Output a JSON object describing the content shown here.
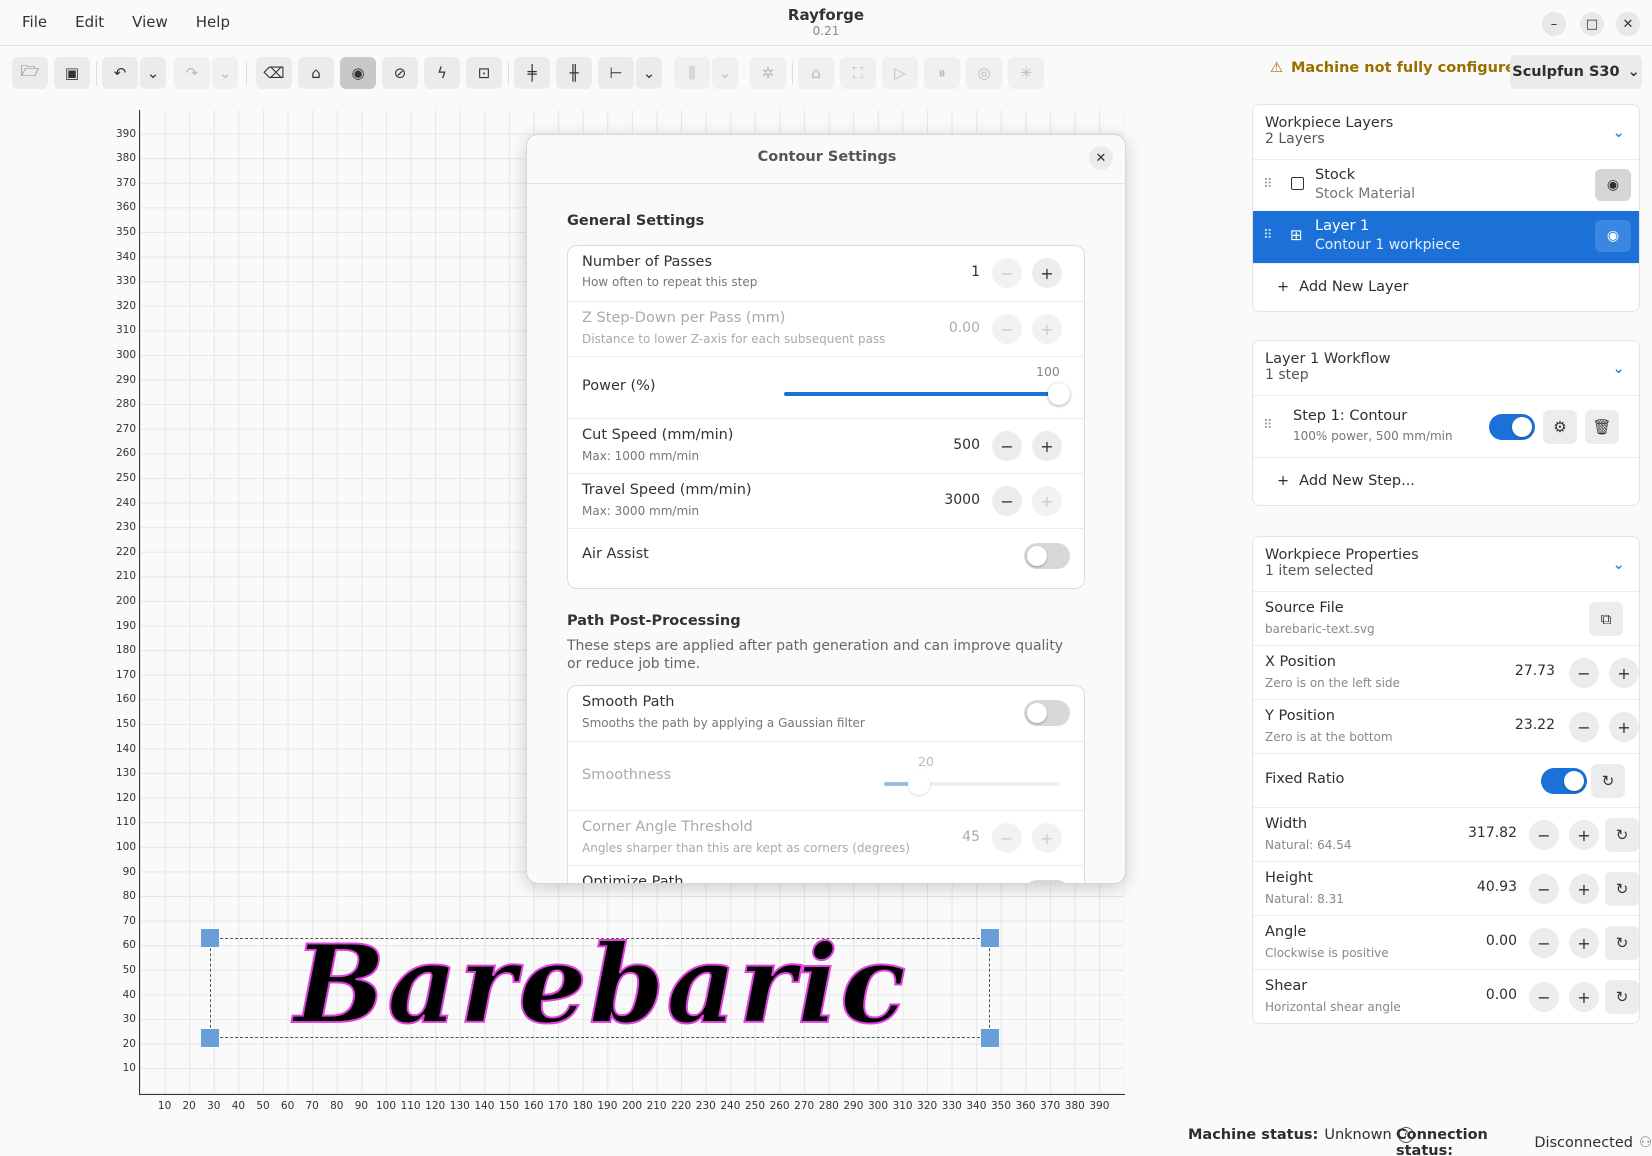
{
  "menu": [
    "File",
    "Edit",
    "View",
    "Help"
  ],
  "app": {
    "title": "Rayforge",
    "version": "0.21"
  },
  "window_controls": {
    "minimize": "–",
    "maximize": "□",
    "close": "✕"
  },
  "toolbar": {
    "warning": "Machine not fully configured",
    "machine": "Sculpfun S30"
  },
  "canvas": {
    "y_ticks": [
      "390",
      "380",
      "370",
      "360",
      "350",
      "340",
      "330",
      "320",
      "310",
      "300",
      "290",
      "280",
      "270",
      "260",
      "250",
      "240",
      "230",
      "220",
      "210",
      "200",
      "190",
      "180",
      "170",
      "160",
      "150",
      "140",
      "130",
      "120",
      "110",
      "100",
      "90",
      "80",
      "70",
      "60",
      "50",
      "40",
      "30",
      "20",
      "10"
    ],
    "x_ticks": [
      "10",
      "20",
      "30",
      "40",
      "50",
      "60",
      "70",
      "80",
      "90",
      "100",
      "110",
      "120",
      "130",
      "140",
      "150",
      "160",
      "170",
      "180",
      "190",
      "200",
      "210",
      "220",
      "230",
      "240",
      "250",
      "260",
      "270",
      "280",
      "290",
      "300",
      "310",
      "320",
      "330",
      "340",
      "350",
      "360",
      "370",
      "380",
      "390"
    ],
    "workpiece_text": "Barebaric"
  },
  "dialog": {
    "title": "Contour Settings",
    "general_title": "General Settings",
    "passes": {
      "label": "Number of Passes",
      "hint": "How often to repeat this step",
      "value": "1"
    },
    "zstep": {
      "label": "Z Step-Down per Pass (mm)",
      "hint": "Distance to lower Z-axis for each subsequent pass",
      "value": "0.00"
    },
    "power": {
      "label": "Power (%)",
      "value": "100"
    },
    "cut_speed": {
      "label": "Cut Speed (mm/min)",
      "hint": "Max: 1000 mm/min",
      "value": "500"
    },
    "travel_speed": {
      "label": "Travel Speed (mm/min)",
      "hint": "Max: 3000 mm/min",
      "value": "3000"
    },
    "air_assist": {
      "label": "Air Assist",
      "on": false
    },
    "post_title": "Path Post-Processing",
    "post_desc": "These steps are applied after path generation and can improve quality or reduce job time.",
    "smooth": {
      "label": "Smooth Path",
      "hint": "Smooths the path by applying a Gaussian filter",
      "on": false
    },
    "smoothness": {
      "label": "Smoothness",
      "value": "20"
    },
    "corner": {
      "label": "Corner Angle Threshold",
      "hint": "Angles sharper than this are kept as corners (degrees)",
      "value": "45"
    },
    "optimize": {
      "label": "Optimize Path"
    }
  },
  "layers_panel": {
    "title": "Workpiece Layers",
    "subtitle": "2 Layers",
    "layers": [
      {
        "name": "Stock",
        "desc": "Stock Material",
        "selected": false
      },
      {
        "name": "Layer 1",
        "desc": "Contour 1 workpiece",
        "selected": true
      }
    ],
    "add_label": "Add New Layer"
  },
  "workflow_panel": {
    "title": "Layer 1 Workflow",
    "subtitle": "1 step",
    "step_name": "Step 1: Contour",
    "step_desc": "100% power, 500 mm/min",
    "step_enabled": true,
    "add_label": "Add New Step..."
  },
  "props_panel": {
    "title": "Workpiece Properties",
    "subtitle": "1 item selected",
    "source_file": {
      "label": "Source File",
      "value": "barebaric-text.svg"
    },
    "x_pos": {
      "label": "X Position",
      "hint": "Zero is on the left side",
      "value": "27.73"
    },
    "y_pos": {
      "label": "Y Position",
      "hint": "Zero is at the bottom",
      "value": "23.22"
    },
    "fixed_ratio": {
      "label": "Fixed Ratio",
      "on": true
    },
    "width": {
      "label": "Width",
      "hint": "Natural: 64.54",
      "value": "317.82"
    },
    "height": {
      "label": "Height",
      "hint": "Natural: 8.31",
      "value": "40.93"
    },
    "angle": {
      "label": "Angle",
      "hint": "Clockwise is positive",
      "value": "0.00"
    },
    "shear": {
      "label": "Shear",
      "hint": "Horizontal shear angle",
      "value": "0.00"
    }
  },
  "status": {
    "machine_label": "Machine status:",
    "machine_value": "Unknown",
    "connection_label": "Connection status:",
    "connection_value": "Disconnected"
  },
  "colors": {
    "accent": "#1c71d8",
    "warning": "#9c6e00",
    "outline": "#e040e0"
  }
}
